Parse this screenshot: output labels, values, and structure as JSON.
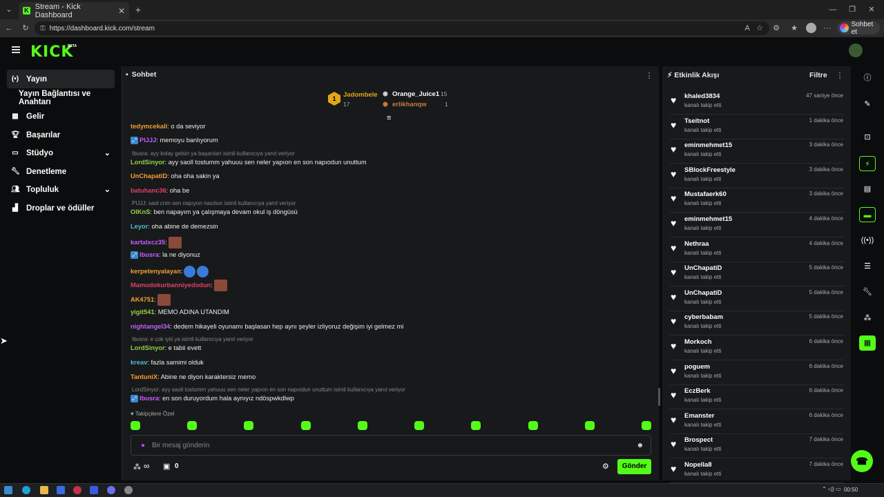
{
  "browser": {
    "tab_title": "Stream - Kick Dashboard",
    "url": "https://dashboard.kick.com/stream",
    "copilot_label": "Sohbet et"
  },
  "header": {
    "logo": "KICK",
    "beta": "BETA"
  },
  "sidebar": {
    "items": [
      {
        "label": "Yayın",
        "icon": "broadcast-icon",
        "active": true
      },
      {
        "label": "Yayın Bağlantısı ve Anahtarı",
        "icon": "",
        "active": false
      },
      {
        "label": "Gelir",
        "icon": "chart-icon"
      },
      {
        "label": "Başarılar",
        "icon": "trophy-icon"
      },
      {
        "label": "Stüdyo",
        "icon": "studio-icon",
        "expandable": true
      },
      {
        "label": "Denetleme",
        "icon": "wrench-icon"
      },
      {
        "label": "Topluluk",
        "icon": "people-icon",
        "expandable": true
      },
      {
        "label": "Droplar ve ödüller",
        "icon": "gift-icon"
      }
    ]
  },
  "chat": {
    "title": "Sohbet",
    "leaderboard": [
      {
        "rank": "1",
        "name": "Jadombele",
        "count": "17"
      },
      {
        "name": "Orange_Juice1",
        "count": "15"
      },
      {
        "name": "erlikhanqw",
        "count": "1"
      }
    ],
    "messages": [
      {
        "user": "tedymcekali",
        "color": "#f0a030",
        "text": ": o da seviyor"
      },
      {
        "user": "PIJJJ",
        "color": "#c060ff",
        "text": ": memoyu banlıyorum"
      },
      {
        "reply": "Ibusra: ayy kolay gelsin ya başarılarr isimli kullanıcıya yanıt veriyor"
      },
      {
        "user": "LordSinyor",
        "color": "#8fd44a",
        "text": ": ayy saoll tostumm yahuuu sen neler yapıon en son napıodun unuttum"
      },
      {
        "user": "UnChapatiD",
        "color": "#f0a030",
        "text": ": oha oha sakin ya"
      },
      {
        "user": "batuhanc36",
        "color": "#e0406a",
        "text": ": oha be"
      },
      {
        "reply": "PIJJJ: saol cnm sen napıyon nasılsın isimli kullanıcıya yanıt veriyor"
      },
      {
        "user": "OlKnS",
        "color": "#8fd44a",
        "text": ": ben napayım ya çalışmaya devam okul iş döngüsü"
      },
      {
        "user": "Leyor",
        "color": "#4ac0d4",
        "text": ": oha abine de demezsin"
      },
      {
        "user": "kartalxcz35",
        "color": "#c060ff",
        "text": ":"
      },
      {
        "user": "Ibusra",
        "color": "#c060ff",
        "text": ": la ne diyonuz"
      },
      {
        "user": "kerpetenyalayan",
        "color": "#f0a030",
        "text": ":"
      },
      {
        "user": "Mamudokurbanniyedodun",
        "color": "#e0406a",
        "text": ":"
      },
      {
        "user": "AK4751",
        "color": "#f0a030",
        "text": ":"
      },
      {
        "user": "yigit541",
        "color": "#8fd44a",
        "text": ": MEMO ADINA UTANDIM"
      },
      {
        "user": "nightangel34",
        "color": "#c060ff",
        "text": ": dedem hikayeli oyunamı başlasan hep aynı şeyler izliyoruz değişim iyi gelmez mi"
      },
      {
        "reply": "Ibusra: e çok iyiii ya isimli kullanıcıya yanıt veriyor"
      },
      {
        "user": "LordSinyor",
        "color": "#8fd44a",
        "text": ": e tabii evett"
      },
      {
        "user": "kreav",
        "color": "#4ac0d4",
        "text": ": fazla samimi olduk"
      },
      {
        "user": "TantuniX",
        "color": "#f0a030",
        "text": ": Abine ne diyon karaktersiz memo"
      },
      {
        "reply": "LordSinyor: ayy saoll tostumm yahuuu sen neler yapıon en son napıodun unuttum isimli kullanıcıya yanıt veriyor"
      },
      {
        "user": "Ibusra",
        "color": "#c060ff",
        "text": ": en son duruyordum hala aynıyız ndöspwkdlwp"
      }
    ],
    "followers_label": "Takipçilere Özel",
    "input_placeholder": "Bir mesaj gönderin",
    "viewer_count": "0",
    "send_label": "Gönder",
    "infinity": "∞"
  },
  "activity": {
    "title": "Etkinlik Akışı",
    "filter_label": "Filtre",
    "items": [
      {
        "name": "khaled3834",
        "sub": "kanalı takip etti",
        "time": "47 saniye önce"
      },
      {
        "name": "Tseitnot",
        "sub": "kanalı takip etti",
        "time": "1 dakika önce"
      },
      {
        "name": "eminmehmet15",
        "sub": "kanalı takip etti",
        "time": "3 dakika önce"
      },
      {
        "name": "SBlockFreestyle",
        "sub": "kanalı takip etti",
        "time": "3 dakika önce"
      },
      {
        "name": "Mustafaerk60",
        "sub": "kanalı takip etti",
        "time": "3 dakika önce"
      },
      {
        "name": "eminmehmet15",
        "sub": "kanalı takip etti",
        "time": "4 dakika önce"
      },
      {
        "name": "Nethraa",
        "sub": "kanalı takip etti",
        "time": "4 dakika önce"
      },
      {
        "name": "UnChapatiD",
        "sub": "kanalı takip etti",
        "time": "5 dakika önce"
      },
      {
        "name": "UnChapatiD",
        "sub": "kanalı takip etti",
        "time": "5 dakika önce"
      },
      {
        "name": "cyberbabam",
        "sub": "kanalı takip etti",
        "time": "5 dakika önce"
      },
      {
        "name": "Morkoch",
        "sub": "kanalı takip etti",
        "time": "6 dakika önce"
      },
      {
        "name": "poguem",
        "sub": "kanalı takip etti",
        "time": "6 dakika önce"
      },
      {
        "name": "EczBerk",
        "sub": "kanalı takip etti",
        "time": "6 dakika önce"
      },
      {
        "name": "Emanster",
        "sub": "kanalı takip etti",
        "time": "6 dakika önce"
      },
      {
        "name": "Brospect",
        "sub": "kanalı takip etti",
        "time": "7 dakika önce"
      },
      {
        "name": "Nopella8",
        "sub": "kanalı takip etti",
        "time": "7 dakika önce"
      }
    ]
  },
  "taskbar": {
    "clock": "00:50"
  },
  "colors": {
    "accent": "#53fc18",
    "panel": "#18191b",
    "bg": "#0b0c0d"
  }
}
